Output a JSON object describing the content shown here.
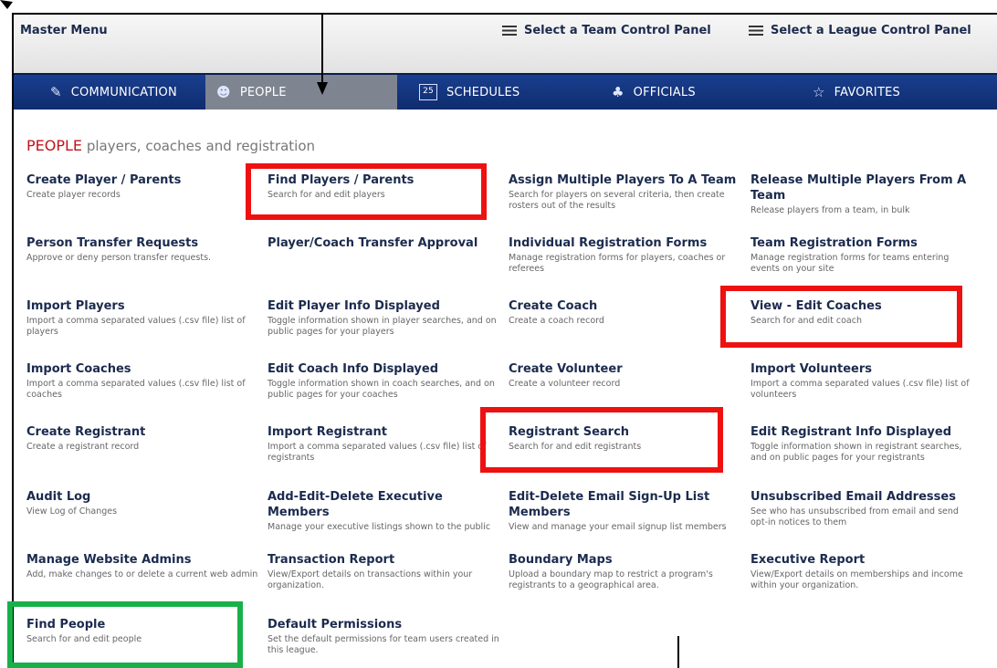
{
  "topbar": {
    "master_menu": "Master Menu",
    "select_team": "Select a Team Control Panel",
    "select_league": "Select a League Control Panel"
  },
  "nav": [
    {
      "label": "COMMUNICATION",
      "icon": "pencil-icon"
    },
    {
      "label": "PEOPLE",
      "icon": "people-icon"
    },
    {
      "label": "SCHEDULES",
      "icon": "calendar-icon",
      "icon_text": "25"
    },
    {
      "label": "OFFICIALS",
      "icon": "officials-icon"
    },
    {
      "label": "FAVORITES",
      "icon": "star-icon"
    }
  ],
  "heading": {
    "title": "PEOPLE",
    "subtitle": "players, coaches and registration"
  },
  "items": [
    {
      "title": "Create Player / Parents",
      "desc": "Create player records"
    },
    {
      "title": "Find Players / Parents",
      "desc": "Search for and edit players"
    },
    {
      "title": "Assign Multiple Players To A Team",
      "desc": "Search for players on several criteria, then create rosters out of the results"
    },
    {
      "title": "Release Multiple Players From A Team",
      "desc": "Release players from a team, in bulk"
    },
    {
      "title": "Person Transfer Requests",
      "desc": "Approve or deny person transfer requests."
    },
    {
      "title": "Player/Coach Transfer Approval",
      "desc": ""
    },
    {
      "title": "Individual Registration Forms",
      "desc": "Manage registration forms for players, coaches or referees"
    },
    {
      "title": "Team Registration Forms",
      "desc": "Manage registration forms for teams entering events on your site"
    },
    {
      "title": "Import Players",
      "desc": "Import a comma separated values (.csv file) list of players"
    },
    {
      "title": "Edit Player Info Displayed",
      "desc": "Toggle information shown in player searches, and on public pages for your players"
    },
    {
      "title": "Create Coach",
      "desc": "Create a coach record"
    },
    {
      "title": "View - Edit Coaches",
      "desc": "Search for and edit coach"
    },
    {
      "title": "Import Coaches",
      "desc": "Import a comma separated values (.csv file) list of coaches"
    },
    {
      "title": "Edit Coach Info Displayed",
      "desc": "Toggle information shown in coach searches, and on public pages for your coaches"
    },
    {
      "title": "Create Volunteer",
      "desc": "Create a volunteer record"
    },
    {
      "title": "Import Volunteers",
      "desc": "Import a comma separated values (.csv file) list of volunteers"
    },
    {
      "title": "Create Registrant",
      "desc": "Create a registrant record"
    },
    {
      "title": "Import Registrant",
      "desc": "Import a comma separated values (.csv file) list of registrants"
    },
    {
      "title": "Registrant Search",
      "desc": "Search for and edit registrants"
    },
    {
      "title": "Edit Registrant Info Displayed",
      "desc": "Toggle information shown in registrant searches, and on public pages for your registrants"
    },
    {
      "title": "Audit Log",
      "desc": "View Log of Changes"
    },
    {
      "title": "Add-Edit-Delete Executive Members",
      "desc": "Manage your executive listings shown to the public"
    },
    {
      "title": "Edit-Delete Email Sign-Up List Members",
      "desc": "View and manage your email signup list members"
    },
    {
      "title": "Unsubscribed Email Addresses",
      "desc": "See who has unsubscribed from email and send opt-in notices to them"
    },
    {
      "title": "Manage Website Admins",
      "desc": "Add, make changes to or delete a current web admin"
    },
    {
      "title": "Transaction Report",
      "desc": "View/Export details on transactions within your organization."
    },
    {
      "title": "Boundary Maps",
      "desc": "Upload a boundary map to restrict a program's registrants to a geographical area."
    },
    {
      "title": "Executive Report",
      "desc": "View/Export details on memberships and income within your organization."
    },
    {
      "title": "Find People",
      "desc": "Search for and edit people"
    },
    {
      "title": "Default Permissions",
      "desc": "Set the default permissions for team users created in this league."
    }
  ],
  "colors": {
    "nav_bg": "#123479",
    "title": "#1b2b4e",
    "heading_red": "#c0141a",
    "highlight_red": "#ee1111",
    "highlight_green": "#19b04a"
  }
}
